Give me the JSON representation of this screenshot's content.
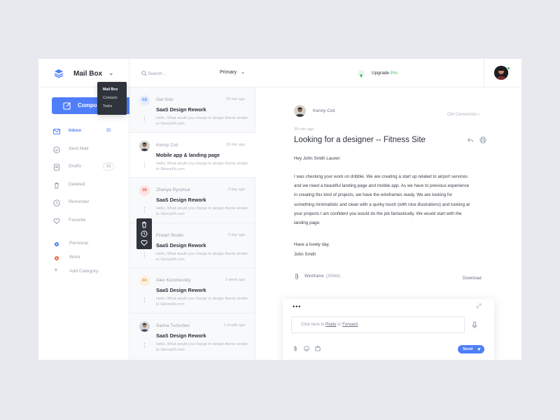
{
  "brand": {
    "title": "Mail Box"
  },
  "dropdown": {
    "items": [
      "Mail Box",
      "Contacts",
      "Tasks"
    ]
  },
  "compose": {
    "label": "Compose"
  },
  "nav": [
    {
      "label": "Inbox",
      "count": "35",
      "icon": "inbox-icon",
      "active": true
    },
    {
      "label": "Sent Mail",
      "count": "",
      "icon": "sent-icon"
    },
    {
      "label": "Drafts",
      "count": "15",
      "icon": "drafts-icon"
    },
    {
      "label": "Deleted",
      "count": "",
      "icon": "trash-icon"
    },
    {
      "label": "Reminder",
      "count": "",
      "icon": "clock-icon"
    },
    {
      "label": "Favorite",
      "count": "",
      "icon": "heart-icon"
    }
  ],
  "categories": [
    {
      "label": "Personal",
      "color": "#4f7ef8"
    },
    {
      "label": "Work",
      "color": "#f2623f"
    },
    {
      "label": "Add Category"
    }
  ],
  "search": {
    "placeholder": "Search..."
  },
  "filter": {
    "label": "Primary"
  },
  "mails": [
    {
      "initials": "GS",
      "badge_bg": "#e6eefe",
      "badge_fg": "#4f7ef8",
      "sender": "Gal Snix",
      "time": "25 min ago",
      "subject": "SaaS Design Rework",
      "preview": "Hello, What would you charge to design theme similar to SkinnyFit.com"
    },
    {
      "photo": true,
      "sender": "Kenny Coil",
      "time": "30 min ago",
      "subject": "Mobile app & landing page",
      "preview": "Hello, What would you charge to design theme similar to SkinnyFit.com",
      "selected": true
    },
    {
      "initials": "ZR",
      "badge_bg": "#fde3e3",
      "badge_fg": "#e25b5b",
      "sender": "Zhenya Rynzhuk",
      "time": "3 day ago",
      "subject": "SaaS Design Rework",
      "preview": "Hello, What would you charge to design theme similar to SkinnyFit.com"
    },
    {
      "initials": "",
      "badge_bg": "#e8ebf0",
      "badge_fg": "#9aa1ae",
      "sender": "Fireart Studio",
      "time": "5 day ago",
      "subject": "SaaS Design Rework",
      "preview": "Hello, What would you charge to design theme similar to SkinnyFit.com"
    },
    {
      "initials": "AK",
      "badge_bg": "#fdf0dd",
      "badge_fg": "#e7a33e",
      "sender": "Alex Kunchevsky",
      "time": "1 week ago",
      "subject": "SaaS Design Rework",
      "preview": "Hello, What would you charge to design theme similar to SkinnyFit.com"
    },
    {
      "photo": true,
      "sender": "Sasha Turischev",
      "time": "1 month ago",
      "subject": "SaaS Design Rework",
      "preview": "Hello, What would you charge to design theme similar to SkinnyFit.com"
    }
  ],
  "upgrade": {
    "prefix": "Upgrade",
    "suffix": "Pro"
  },
  "reader": {
    "sender": "Kenny Coil",
    "conversation_link": "Old Conversion",
    "time": "30 min ago",
    "subject": "Looking for a designer -- Fitness Site",
    "greeting": "Hey John Smith Lauren",
    "body": "I was checking your work on dribble. We are creating a start up related to airport services and we need a beautiful landing page and mobile app. As we have to previous experience in creating this kind of projects, we have the wireframes ready. We are looking for something minimalistic and clean with a quirky touch (with nice illustrations) and looking at your projects I am confident you would do the job fantastically. We would start with the landing page.",
    "sign_off": "Have a lovely day,",
    "signature": "John Smith",
    "attachment": "Wireframe",
    "attachment_size": "(350kb)",
    "download_label": "Download"
  },
  "reply": {
    "dots": "•••",
    "prefix": "Click here to",
    "reply_link": "Reply",
    "or": "or",
    "forward_link": "Forward",
    "send_label": "Send"
  }
}
